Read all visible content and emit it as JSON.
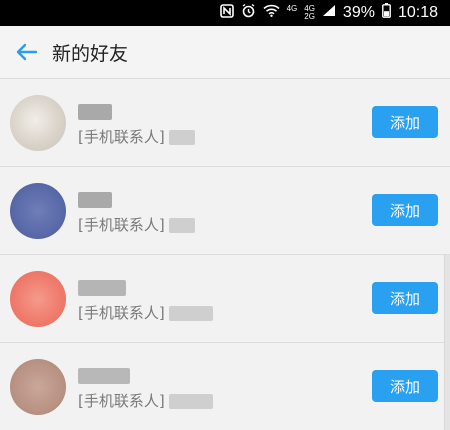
{
  "status_bar": {
    "nfc_icon": "nfc-icon",
    "alarm_icon": "alarm-icon",
    "wifi_icon": "wifi-icon",
    "network_top": "4G",
    "network_label": "4G",
    "network_sub": "2G",
    "battery_percent": "39%",
    "time": "10:18"
  },
  "header": {
    "back_icon": "back-arrow-icon",
    "title": "新的好友"
  },
  "friends": [
    {
      "source": "[手机联系人]",
      "add_label": "添加"
    },
    {
      "source": "[手机联系人]",
      "add_label": "添加"
    },
    {
      "source": "[手机联系人]",
      "add_label": "添加"
    },
    {
      "source": "[手机联系人]",
      "add_label": "添加"
    }
  ],
  "colors": {
    "accent": "#2aa0f0",
    "avatar_1": "#d9d3c9",
    "avatar_2": "#5a69a8",
    "avatar_3": "#ef7a6b",
    "avatar_4": "#b99384"
  }
}
